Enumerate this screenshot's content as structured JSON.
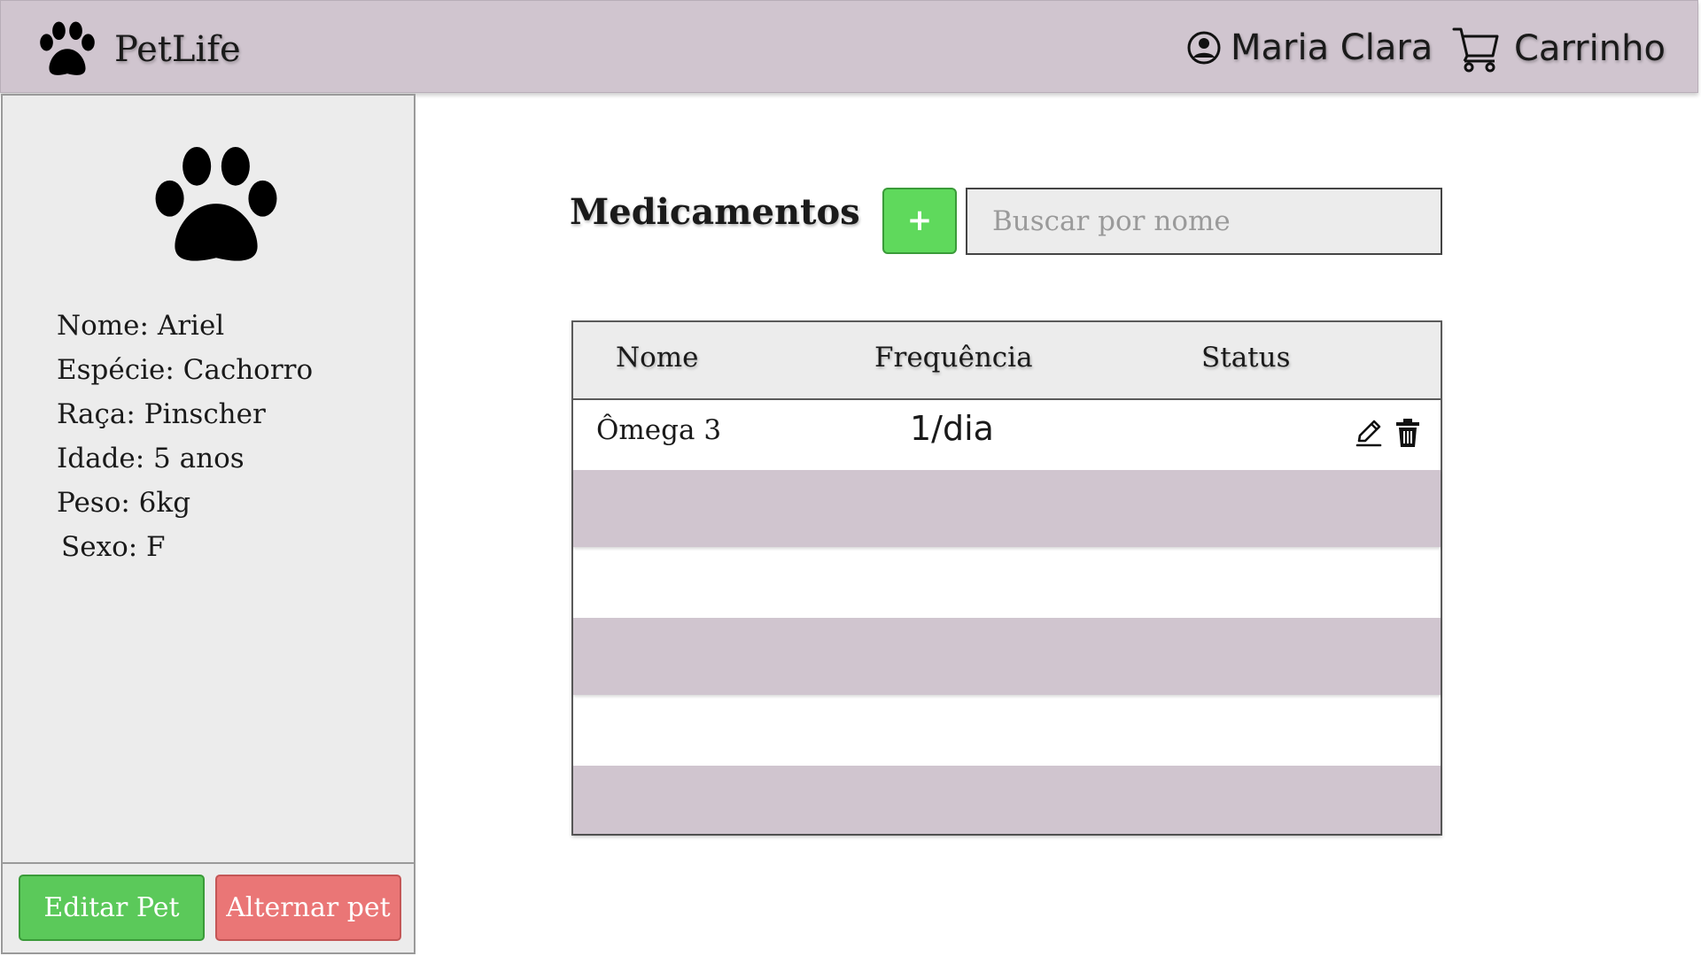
{
  "header": {
    "brand": "PetLife",
    "user_name": "Maria Clara",
    "cart_label": "Carrinho"
  },
  "pet": {
    "lines": [
      "Nome: Ariel",
      "Espécie: Cachorro",
      "Raça: Pinscher",
      "Idade: 5 anos",
      "Peso: 6kg",
      "Sexo: F"
    ],
    "edit_label": "Editar Pet",
    "switch_label": "Alternar pet"
  },
  "medications": {
    "title": "Medicamentos",
    "add_label": "+",
    "search_placeholder": "Buscar por nome",
    "columns": [
      "Nome",
      "Frequência",
      "Status"
    ],
    "rows": [
      {
        "nome": "Ômega 3",
        "frequencia": "1/dia",
        "status": ""
      }
    ]
  },
  "colors": {
    "topbar": "#d0c5cf",
    "row_stripe": "#d0c5cf",
    "edit_button": "#5bc95a",
    "switch_button": "#ea7676",
    "add_button": "#5fd95c"
  },
  "icons": [
    "paw-icon",
    "user-circle-icon",
    "cart-icon",
    "pencil-icon",
    "trash-icon"
  ]
}
